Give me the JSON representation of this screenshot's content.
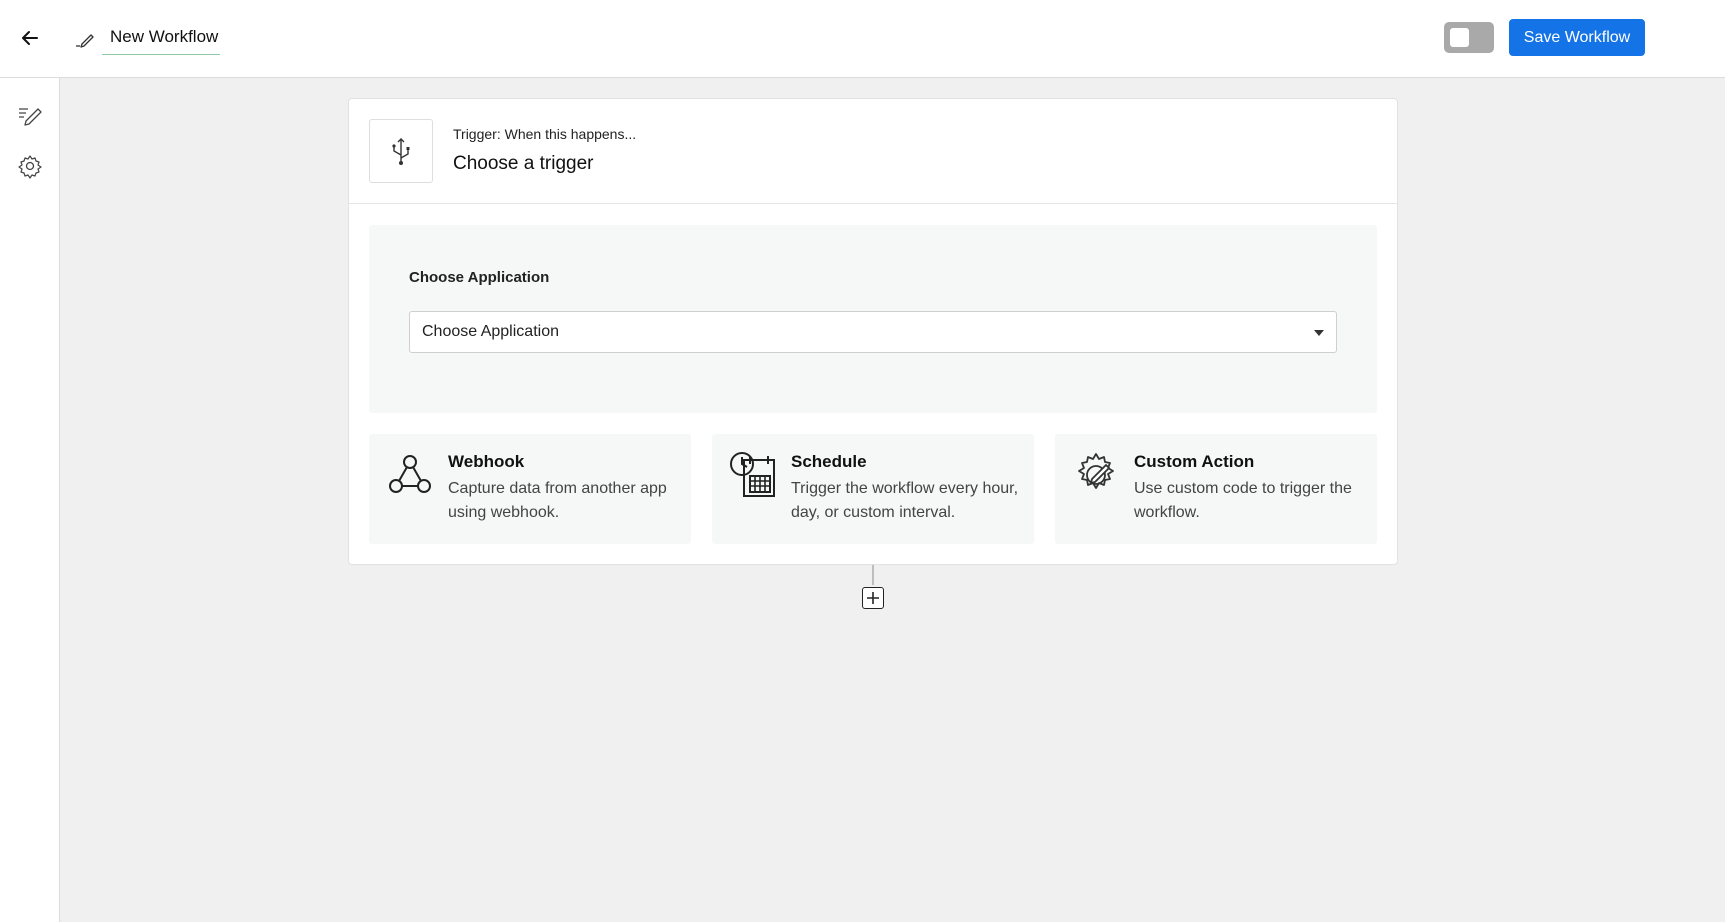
{
  "header": {
    "workflow_name": "New Workflow",
    "save_label": "Save Workflow",
    "toggle_on": false
  },
  "sidebar": {
    "items": [
      {
        "icon": "edit-icon"
      },
      {
        "icon": "gear-icon"
      }
    ]
  },
  "trigger": {
    "subtitle": "Trigger: When this happens...",
    "title": "Choose a trigger",
    "icon": "usb-icon"
  },
  "application": {
    "label": "Choose Application",
    "selected": "Choose Application"
  },
  "options": [
    {
      "title": "Webhook",
      "description": "Capture data from another app using webhook.",
      "icon": "webhook-icon"
    },
    {
      "title": "Schedule",
      "description": "Trigger the workflow every hour, day, or custom interval.",
      "icon": "schedule-icon"
    },
    {
      "title": "Custom Action",
      "description": "Use custom code to trigger the workflow.",
      "icon": "custom-action-icon"
    }
  ],
  "colors": {
    "primary": "#1473e6",
    "toggle_off": "#a9a9a9",
    "canvas_bg": "#f0f0f0",
    "panel_bg": "#f6f7f7"
  }
}
